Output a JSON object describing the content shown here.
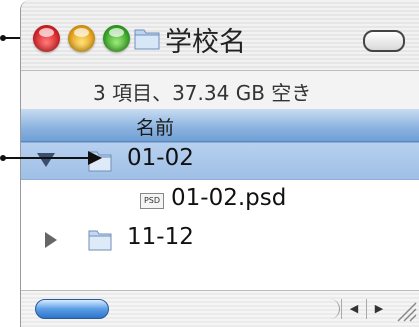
{
  "window": {
    "title": "学校名",
    "status": "3 項目、37.34 GB 空き"
  },
  "list_header": {
    "name_column": "名前"
  },
  "rows": [
    {
      "label": "01-02",
      "expanded": true,
      "selected": true,
      "icon": "folder-icon"
    },
    {
      "label": "01-02.psd",
      "icon": "psd-file-icon",
      "badge": "PSD"
    },
    {
      "label": "11-12",
      "expanded": false,
      "selected": false,
      "icon": "folder-icon"
    }
  ],
  "scrollbar": {
    "left_arrow": "◀",
    "right_arrow": "▶"
  },
  "colors": {
    "selection": "#9fbfe6",
    "header": "#8fb5e0",
    "close": "#d9262a",
    "minimize": "#e6a21a",
    "zoom": "#3aa72a"
  }
}
